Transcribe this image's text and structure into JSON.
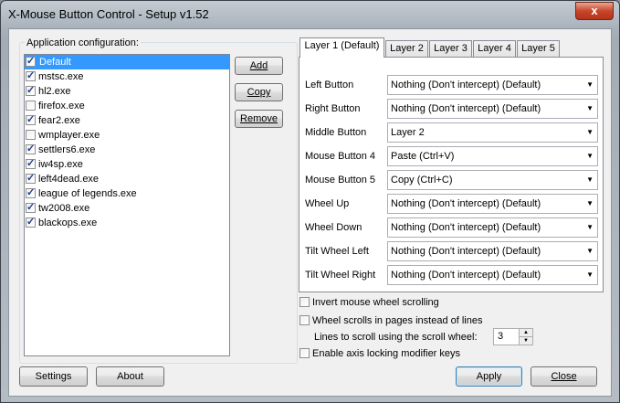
{
  "window": {
    "title": "X-Mouse Button Control - Setup v1.52",
    "close_glyph": "x"
  },
  "app_config": {
    "label": "Application configuration:",
    "items": [
      {
        "name": "Default",
        "checked": true,
        "selected": true
      },
      {
        "name": "mstsc.exe",
        "checked": true
      },
      {
        "name": "hl2.exe",
        "checked": true
      },
      {
        "name": "firefox.exe",
        "checked": false
      },
      {
        "name": "fear2.exe",
        "checked": true
      },
      {
        "name": "wmplayer.exe",
        "checked": false
      },
      {
        "name": "settlers6.exe",
        "checked": true
      },
      {
        "name": "iw4sp.exe",
        "checked": true
      },
      {
        "name": "left4dead.exe",
        "checked": true
      },
      {
        "name": "league of legends.exe",
        "checked": true
      },
      {
        "name": "tw2008.exe",
        "checked": true
      },
      {
        "name": "blackops.exe",
        "checked": true
      }
    ],
    "add_label": "Add",
    "copy_label": "Copy",
    "remove_label": "Remove"
  },
  "tabs": [
    "Layer 1 (Default)",
    "Layer 2",
    "Layer 3",
    "Layer 4",
    "Layer 5"
  ],
  "active_tab": 0,
  "mappings": [
    {
      "label": "Left Button",
      "value": "Nothing (Don't intercept) (Default)"
    },
    {
      "label": "Right Button",
      "value": "Nothing (Don't intercept) (Default)"
    },
    {
      "label": "Middle Button",
      "value": "Layer 2"
    },
    {
      "label": "Mouse Button 4",
      "value": "Paste (Ctrl+V)"
    },
    {
      "label": "Mouse Button 5",
      "value": "Copy (Ctrl+C)"
    },
    {
      "label": "Wheel Up",
      "value": "Nothing (Don't intercept) (Default)"
    },
    {
      "label": "Wheel Down",
      "value": "Nothing (Don't intercept) (Default)"
    },
    {
      "label": "Tilt Wheel Left",
      "value": "Nothing (Don't intercept) (Default)"
    },
    {
      "label": "Tilt Wheel Right",
      "value": "Nothing (Don't intercept) (Default)"
    }
  ],
  "options": {
    "invert_label": "Invert mouse wheel scrolling",
    "invert_checked": false,
    "pages_label": "Wheel scrolls in pages instead of lines",
    "pages_checked": false,
    "lines_label": "Lines to scroll using the scroll wheel:",
    "lines_value": "3",
    "axis_label": "Enable axis locking modifier keys",
    "axis_checked": false
  },
  "footer": {
    "settings_label": "Settings",
    "about_label": "About",
    "apply_label": "Apply",
    "close_label": "Close"
  },
  "colors": {
    "selection": "#3399ff",
    "close_button": "#c8462b"
  }
}
